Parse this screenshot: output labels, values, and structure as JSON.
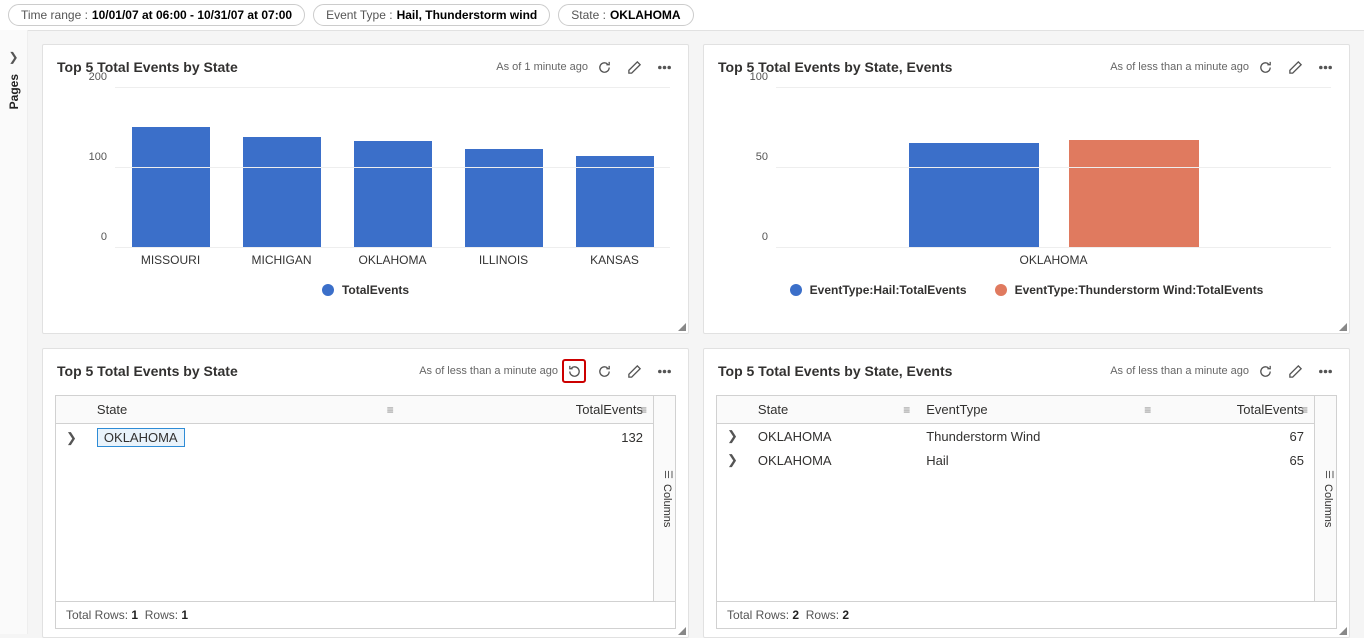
{
  "filters": {
    "time_label": "Time range :",
    "time_value": "10/01/07 at 06:00 - 10/31/07 at 07:00",
    "eventtype_label": "Event Type :",
    "eventtype_value": "Hail, Thunderstorm wind",
    "state_label": "State :",
    "state_value": "OKLAHOMA"
  },
  "sidebar": {
    "pages": "Pages"
  },
  "tiles": {
    "tl": {
      "title": "Top 5 Total Events by State",
      "status": "As of 1 minute ago",
      "legend0": "TotalEvents"
    },
    "tr": {
      "title": "Top 5 Total Events by State, Events",
      "status": "As of less than a minute ago",
      "legend0": "EventType:Hail:TotalEvents",
      "legend1": "EventType:Thunderstorm Wind:TotalEvents"
    },
    "bl": {
      "title": "Top 5 Total Events by State",
      "status": "As of less than a minute ago",
      "col_state": "State",
      "col_total": "TotalEvents",
      "rows": [
        {
          "state": "OKLAHOMA",
          "total": "132"
        }
      ],
      "footer_label_total": "Total Rows:",
      "footer_total": "1",
      "footer_label_rows": "Rows:",
      "footer_rows": "1",
      "columns_label": "Columns"
    },
    "br": {
      "title": "Top 5 Total Events by State, Events",
      "status": "As of less than a minute ago",
      "col_state": "State",
      "col_eventtype": "EventType",
      "col_total": "TotalEvents",
      "rows": [
        {
          "state": "OKLAHOMA",
          "eventtype": "Thunderstorm Wind",
          "total": "67"
        },
        {
          "state": "OKLAHOMA",
          "eventtype": "Hail",
          "total": "65"
        }
      ],
      "footer_label_total": "Total Rows:",
      "footer_total": "2",
      "footer_label_rows": "Rows:",
      "footer_rows": "2",
      "columns_label": "Columns"
    }
  },
  "chart_data": [
    {
      "type": "bar",
      "title": "Top 5 Total Events by State",
      "categories": [
        "MISSOURI",
        "MICHIGAN",
        "OKLAHOMA",
        "ILLINOIS",
        "KANSAS"
      ],
      "values": [
        150,
        138,
        132,
        122,
        114
      ],
      "series_name": "TotalEvents",
      "ylim": [
        0,
        200
      ],
      "yticks": [
        0,
        100,
        200
      ],
      "ylabel": "",
      "xlabel": ""
    },
    {
      "type": "bar",
      "title": "Top 5 Total Events by State, Events",
      "categories": [
        "OKLAHOMA"
      ],
      "series": [
        {
          "name": "EventType:Hail:TotalEvents",
          "values": [
            65
          ],
          "color": "#3b6fc9"
        },
        {
          "name": "EventType:Thunderstorm Wind:TotalEvents",
          "values": [
            67
          ],
          "color": "#e07a5f"
        }
      ],
      "ylim": [
        0,
        100
      ],
      "yticks": [
        0,
        50,
        100
      ],
      "ylabel": "",
      "xlabel": ""
    }
  ]
}
